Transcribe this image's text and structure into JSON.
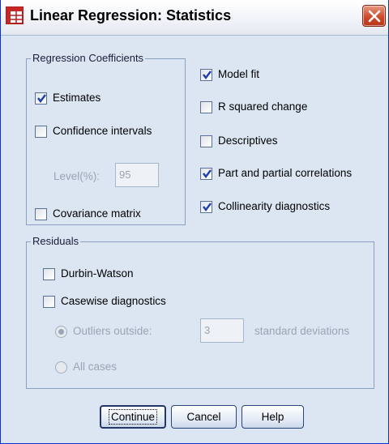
{
  "window": {
    "title": "Linear Regression: Statistics",
    "accent_color": "#0831d9",
    "background_color": "#dbe6f2"
  },
  "regression_coefficients": {
    "legend": "Regression Coefficients",
    "estimates": {
      "label": "Estimates",
      "checked": true
    },
    "confidence_intervals": {
      "label": "Confidence intervals",
      "checked": false
    },
    "level_label": "Level(%):",
    "level_value": "95",
    "covariance_matrix": {
      "label": "Covariance matrix",
      "checked": false
    }
  },
  "options": {
    "model_fit": {
      "label": "Model fit",
      "checked": true
    },
    "r_squared_change": {
      "label": "R squared change",
      "checked": false
    },
    "descriptives": {
      "label": "Descriptives",
      "checked": false
    },
    "part_partial": {
      "label": "Part and partial correlations",
      "checked": true
    },
    "collinearity": {
      "label": "Collinearity diagnostics",
      "checked": true
    }
  },
  "residuals": {
    "legend": "Residuals",
    "durbin_watson": {
      "label": "Durbin-Watson",
      "checked": false
    },
    "casewise": {
      "label": "Casewise diagnostics",
      "checked": false
    },
    "outliers_outside": {
      "label": "Outliers outside:",
      "selected": true
    },
    "outliers_value": "3",
    "std_dev_label": "standard deviations",
    "all_cases": {
      "label": "All cases",
      "selected": false
    }
  },
  "buttons": {
    "continue": "Continue",
    "cancel": "Cancel",
    "help": "Help"
  },
  "icons": {
    "app": "spreadsheet-icon",
    "close": "close-icon",
    "check": "checkmark-icon"
  }
}
